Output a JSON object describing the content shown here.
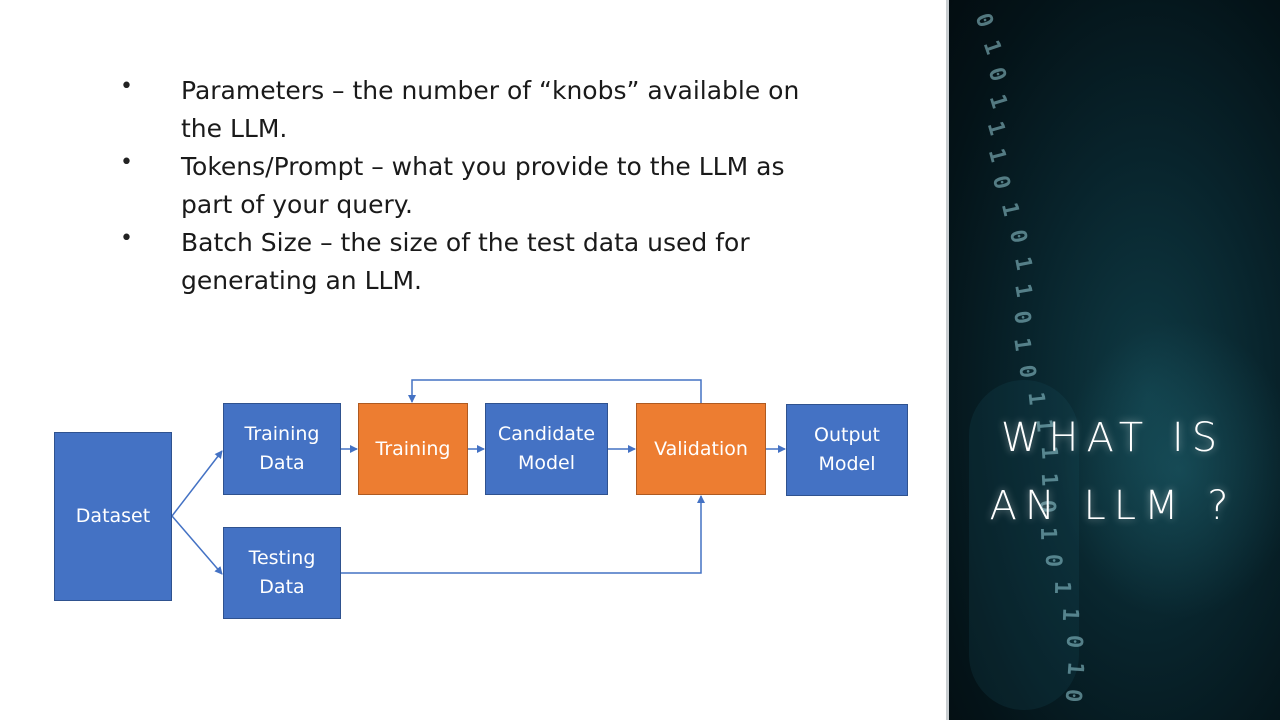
{
  "bullets": [
    "Parameters – the number of “knobs” available on the LLM.",
    "Tokens/Prompt – what you provide to the LLM as part of your query.",
    "Batch Size – the size of the test data used for generating an LLM."
  ],
  "diagram": {
    "dataset": "Dataset",
    "training_data": "Training\nData",
    "testing_data": "Testing\nData",
    "training": "Training",
    "candidate_model": "Candidate\nModel",
    "validation": "Validation",
    "output_model": "Output\nModel",
    "colors": {
      "data_box": "#4472c4",
      "process_box": "#ed7d31",
      "connector": "#4472c4"
    }
  },
  "panel": {
    "title_line1": "WHAT IS",
    "title_line2": "AN LLM ?",
    "background_text": [
      "0",
      "1",
      "0",
      "1",
      "1",
      "1",
      "0",
      "1",
      "0",
      "1",
      "1",
      "0",
      "1",
      "0",
      "1",
      "1",
      "1",
      "1",
      "0",
      "1",
      "0",
      "1",
      "1",
      "0",
      "1",
      "0"
    ]
  }
}
